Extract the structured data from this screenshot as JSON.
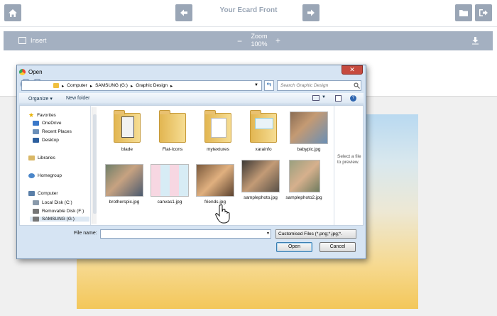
{
  "header": {
    "title": "Your Ecard Front",
    "buttons": {
      "home": "home-icon",
      "back": "arrow-left-icon",
      "forward": "arrow-right-icon",
      "folder": "folder-icon",
      "exit": "exit-icon"
    }
  },
  "toolbar": {
    "insert_label": "Insert",
    "zoom_label": "Zoom",
    "zoom_value": "100%",
    "zoom_out": "−",
    "zoom_in": "+"
  },
  "dialog": {
    "title": "Open",
    "close_symbol": "✕",
    "address": {
      "path": [
        "Computer",
        "SAMSUNG (G:)",
        "Graphic Design"
      ]
    },
    "search_placeholder": "Search Graphic Design",
    "commands": {
      "organize": "Organize ▾",
      "new_folder": "New folder"
    },
    "nav": {
      "favorites": "Favorites",
      "onedrive": "OneDrive",
      "recent": "Recent Places",
      "desktop": "Desktop",
      "libraries": "Libraries",
      "homegroup": "Homegroup",
      "computer": "Computer",
      "local_disk": "Local Disk (C:)",
      "removable": "Removable Disk (F:)",
      "samsung": "SAMSUNG (G:)"
    },
    "files": {
      "f1": "blade",
      "f2": "Flat-Icons",
      "f3": "mytextures",
      "f4": "xarainfo",
      "f5": "babypic.jpg",
      "f6": "brotherspic.jpg",
      "f7": "canvas1.jpg",
      "f8": "friends.jpg",
      "f9": "samplephoto.jpg",
      "f10": "samplephoto2.jpg"
    },
    "preview_text": "Select a file to preview.",
    "filename_label": "File name:",
    "filename_value": "",
    "filter_value": "Customised Files (*.png;*.jpg;*.",
    "open_label": "Open",
    "cancel_label": "Cancel"
  },
  "colors": {
    "accent": "#9aa6b6",
    "toolbar": "#a4b0c1",
    "close": "#c64a3e"
  }
}
